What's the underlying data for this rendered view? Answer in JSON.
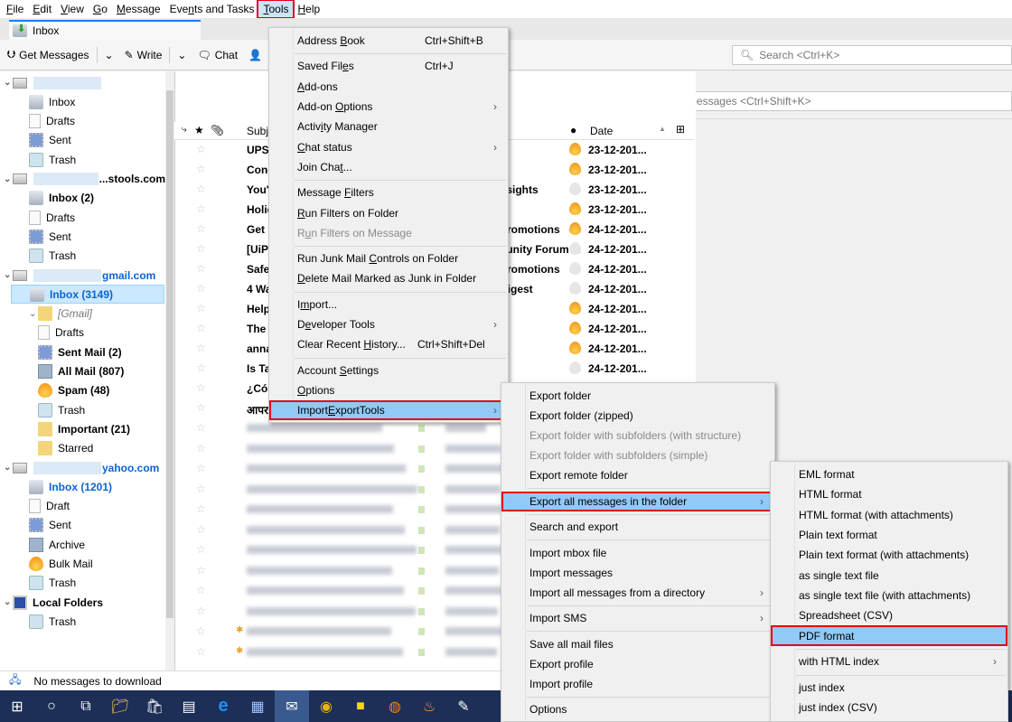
{
  "menubar": {
    "items": [
      "File",
      "Edit",
      "View",
      "Go",
      "Message",
      "Events and Tasks",
      "Tools",
      "Help"
    ],
    "active": "Tools"
  },
  "tab": {
    "label": "Inbox"
  },
  "toolbar": {
    "get_messages": "Get Messages",
    "write": "Write",
    "chat": "Chat",
    "search_placeholder": "Search <Ctrl+K>"
  },
  "quickfilter": {
    "placeholder": "Filter these messages <Ctrl+Shift+K>"
  },
  "folders": [
    {
      "label": "",
      "type": "account",
      "suffix": ""
    },
    {
      "label": "Inbox",
      "type": "inbox"
    },
    {
      "label": "Drafts",
      "type": "drafts"
    },
    {
      "label": "Sent",
      "type": "sent"
    },
    {
      "label": "Trash",
      "type": "trash"
    },
    {
      "label": "...stools.com",
      "type": "account"
    },
    {
      "label": "Inbox (2)",
      "type": "inbox",
      "bold": true
    },
    {
      "label": "Drafts",
      "type": "drafts"
    },
    {
      "label": "Sent",
      "type": "sent"
    },
    {
      "label": "Trash",
      "type": "trash"
    },
    {
      "label": "gmail.com",
      "type": "account"
    },
    {
      "label": "Inbox (3149)",
      "type": "inbox",
      "bold": true,
      "selected": true
    },
    {
      "label": "[Gmail]",
      "type": "folder"
    },
    {
      "label": "Drafts",
      "type": "drafts"
    },
    {
      "label": "Sent Mail (2)",
      "type": "sent",
      "bold": true
    },
    {
      "label": "All Mail (807)",
      "type": "archive",
      "bold": true
    },
    {
      "label": "Spam (48)",
      "type": "junk",
      "bold": true
    },
    {
      "label": "Trash",
      "type": "trash"
    },
    {
      "label": "Important (21)",
      "type": "folder",
      "bold": true
    },
    {
      "label": "Starred",
      "type": "folder"
    },
    {
      "label": "yahoo.com",
      "type": "account"
    },
    {
      "label": "Inbox (1201)",
      "type": "inbox",
      "bold": true
    },
    {
      "label": "Draft",
      "type": "drafts"
    },
    {
      "label": "Sent",
      "type": "sent"
    },
    {
      "label": "Archive",
      "type": "archive"
    },
    {
      "label": "Bulk Mail",
      "type": "junk"
    },
    {
      "label": "Trash",
      "type": "trash"
    },
    {
      "label": "Local Folders",
      "type": "local",
      "bold": true
    },
    {
      "label": "Trash",
      "type": "trash"
    }
  ],
  "columns": {
    "subject": "Subje",
    "date": "Date"
  },
  "messages": [
    {
      "subject": "UPS",
      "correspondent": "",
      "junk": true,
      "date": "23-12-201..."
    },
    {
      "subject": "Cong",
      "correspondent": "",
      "junk": true,
      "date": "23-12-201..."
    },
    {
      "subject": "You'",
      "correspondent": "nsights",
      "junk": false,
      "date": "23-12-201..."
    },
    {
      "subject": "Holic",
      "correspondent": "",
      "junk": true,
      "date": "23-12-201..."
    },
    {
      "subject": "Get",
      "correspondent": "Promotions",
      "junk": true,
      "date": "24-12-201..."
    },
    {
      "subject": "[UiPa",
      "correspondent": "nunity Forum ...",
      "junk": false,
      "date": "24-12-201..."
    },
    {
      "subject": "Safe",
      "correspondent": "Promotions",
      "junk": false,
      "date": "24-12-201..."
    },
    {
      "subject": "4 Wa",
      "correspondent": "Digest",
      "junk": false,
      "date": "24-12-201..."
    },
    {
      "subject": "Help",
      "correspondent": "",
      "junk": true,
      "date": "24-12-201..."
    },
    {
      "subject": "The",
      "correspondent": "",
      "junk": true,
      "date": "24-12-201..."
    },
    {
      "subject": "anna",
      "correspondent": "",
      "junk": true,
      "date": "24-12-201..."
    },
    {
      "subject": "Is Ta",
      "correspondent": "",
      "junk": false,
      "date": "24-12-201..."
    },
    {
      "subject": "¿Cón",
      "correspondent": "",
      "junk": false,
      "date": ""
    },
    {
      "subject": "आपर",
      "correspondent": "",
      "junk": false,
      "date": ""
    }
  ],
  "status": {
    "text": "No messages to download"
  },
  "tools_menu": [
    {
      "label": "Address Book",
      "shortcut": "Ctrl+Shift+B"
    },
    {
      "sep": true
    },
    {
      "label": "Saved Files",
      "shortcut": "Ctrl+J"
    },
    {
      "label": "Add-ons"
    },
    {
      "label": "Add-on Options",
      "submenu": true
    },
    {
      "label": "Activity Manager"
    },
    {
      "label": "Chat status",
      "submenu": true
    },
    {
      "label": "Join Chat..."
    },
    {
      "sep": true
    },
    {
      "label": "Message Filters"
    },
    {
      "label": "Run Filters on Folder"
    },
    {
      "label": "Run Filters on Message",
      "disabled": true
    },
    {
      "sep": true
    },
    {
      "label": "Run Junk Mail Controls on Folder"
    },
    {
      "label": "Delete Mail Marked as Junk in Folder"
    },
    {
      "sep": true
    },
    {
      "label": "Import..."
    },
    {
      "label": "Developer Tools",
      "submenu": true
    },
    {
      "label": "Clear Recent History...",
      "shortcut": "Ctrl+Shift+Del"
    },
    {
      "sep": true
    },
    {
      "label": "Account Settings"
    },
    {
      "label": "Options"
    },
    {
      "label": "ImportExportTools",
      "submenu": true,
      "highlighted": true
    }
  ],
  "iet_menu": [
    {
      "label": "Export folder"
    },
    {
      "label": "Export folder (zipped)"
    },
    {
      "label": "Export folder with subfolders (with structure)",
      "disabled": true
    },
    {
      "label": "Export folder with subfolders (simple)",
      "disabled": true
    },
    {
      "label": "Export remote folder"
    },
    {
      "sep": true
    },
    {
      "label": "Export all messages in the folder",
      "submenu": true,
      "highlighted": true
    },
    {
      "sep": true
    },
    {
      "label": "Search and export"
    },
    {
      "sep": true
    },
    {
      "label": "Import mbox file"
    },
    {
      "label": "Import messages"
    },
    {
      "label": "Import all messages from a directory",
      "submenu": true
    },
    {
      "sep": true
    },
    {
      "label": "Import SMS",
      "submenu": true
    },
    {
      "sep": true
    },
    {
      "label": "Save all mail files"
    },
    {
      "label": "Export profile"
    },
    {
      "label": "Import profile"
    },
    {
      "sep": true
    },
    {
      "label": "Options"
    }
  ],
  "export_menu": [
    {
      "label": "EML format"
    },
    {
      "label": "HTML format"
    },
    {
      "label": "HTML format (with attachments)"
    },
    {
      "label": "Plain text format"
    },
    {
      "label": "Plain text format (with attachments)"
    },
    {
      "label": "as single text file"
    },
    {
      "label": "as single text file (with attachments)"
    },
    {
      "label": "Spreadsheet (CSV)"
    },
    {
      "label": "PDF format",
      "highlighted": true
    },
    {
      "sep": true
    },
    {
      "label": "with HTML index",
      "submenu": true
    },
    {
      "sep": true
    },
    {
      "label": "just index"
    },
    {
      "label": "just index (CSV)"
    }
  ],
  "taskbar": [
    "start",
    "cortana",
    "task-view",
    "file-explorer",
    "store",
    "notepad",
    "edge",
    "writer",
    "thunderbird",
    "chrome",
    "sticky-notes",
    "firefox",
    "app-flame",
    "editor"
  ],
  "colors": {
    "highlight": "#91c9f7",
    "callout": "#e2001a",
    "taskbar": "#1d2f57",
    "selected_folder": "#cce8ff"
  }
}
